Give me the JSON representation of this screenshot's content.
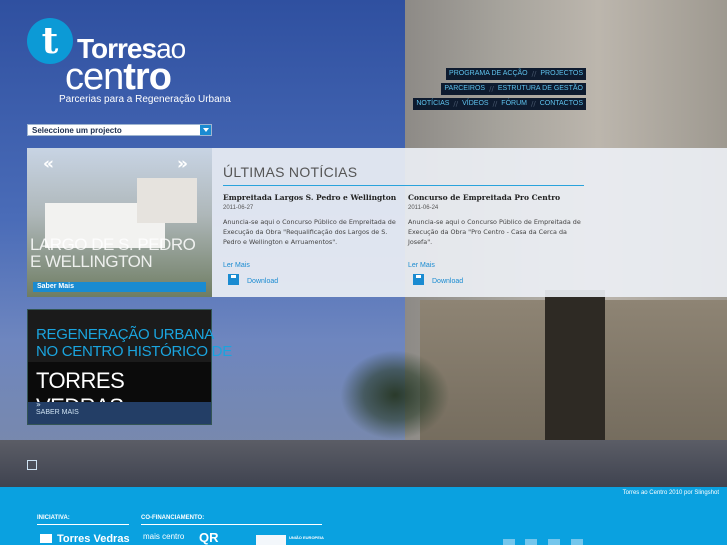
{
  "logo": {
    "word1_bold": "Torres",
    "word1_light": "ao",
    "word2_light": "cen",
    "word2_bold": "tro",
    "tagline": "Parcerias para a Regeneração Urbana"
  },
  "nav": {
    "row1": [
      "PROGRAMA DE ACÇÃO",
      "PROJECTOS"
    ],
    "row2": [
      "PARCEIROS",
      "ESTRUTURA DE GESTÃO"
    ],
    "row3": [
      "NOTÍCIAS",
      "VÍDEOS",
      "FÓRUM",
      "CONTACTOS"
    ]
  },
  "project_select": {
    "label": "Seleccione um projecto"
  },
  "slider": {
    "prev": "«",
    "next": "»",
    "caption_line1": "LARGO DE S. PEDRO",
    "caption_line2": "E WELLINGTON",
    "saber_mais": "Saber Mais"
  },
  "promo": {
    "line1": "REGENERAÇÃO URBANA",
    "line2": "NO CENTRO HISTÓRICO DE",
    "line3": "TORRES VEDRAS",
    "chevron": "»",
    "saber_mais": "SABER MAIS"
  },
  "news": {
    "title": "ÚLTIMAS NOTÍCIAS",
    "articles": [
      {
        "title": "Empreitada Largos S. Pedro e Wellington",
        "date": "2011-06-27",
        "body": "Anuncia-se aqui o Concurso Público de Empreitada de Execução da Obra \"Requalificação dos Largos de S. Pedro e Wellington e Arruamentos\".",
        "more": "Ler Mais",
        "download": "Download"
      },
      {
        "title": "Concurso de Empreitada Pro Centro",
        "date": "2011-06-24",
        "body": "Anuncia-se aqui o Concurso Público de Empreitada de Execução da Obra \"Pro Centro - Casa da Cerca da Josefa\".",
        "more": "Ler Mais",
        "download": "Download"
      }
    ]
  },
  "footer": {
    "credit": "Torres ao Centro 2010 por Slingshot",
    "iniciativa": "INICIATIVA:",
    "cofinanciamento": "CO-FINANCIAMENTO:",
    "torres_vedras": "Torres Vedras",
    "mais_centro": "mais centro",
    "qr": "QR",
    "ue": "UNIÃO EUROPEIA"
  },
  "colors": {
    "accent": "#1a8bd1",
    "footer_bg": "#0aa1e0",
    "nav_bg": "#0e1b2f"
  }
}
